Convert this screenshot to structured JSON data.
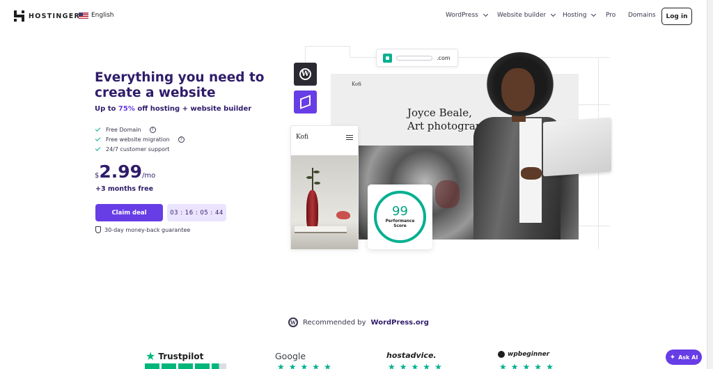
{
  "header": {
    "logo_text": "HOSTINGER",
    "language": "English",
    "nav": [
      {
        "label": "WordPress",
        "has_dropdown": true
      },
      {
        "label": "Website builder",
        "has_dropdown": true
      },
      {
        "label": "Hosting",
        "has_dropdown": true
      },
      {
        "label": "Pro",
        "has_dropdown": false
      },
      {
        "label": "Domains",
        "has_dropdown": false
      }
    ],
    "login_label": "Log in"
  },
  "hero": {
    "title": "Everything you need to create a website",
    "subtitle_prefix": "Up to ",
    "subtitle_highlight": "75%",
    "subtitle_suffix": " off hosting + website builder",
    "features": [
      {
        "label": "Free Domain",
        "has_help": true
      },
      {
        "label": "Free website migration",
        "has_help": true
      },
      {
        "label": "24/7 customer support",
        "has_help": false
      }
    ],
    "price": {
      "currency": "$",
      "amount": "2.99",
      "period": "/mo"
    },
    "bonus": "+3 months free",
    "cta_label": "Claim deal",
    "countdown": "03 : 16 : 05 : 44",
    "guarantee": "30-day money-back guarantee"
  },
  "illustration": {
    "domain_suffix": ".com",
    "site_brand": "Kofi",
    "site_headline": "Joyce Beale,\nArt photograph",
    "mobile_brand": "Kofi",
    "performance_score": "99",
    "performance_label": "Performance\nScore"
  },
  "recommended": {
    "prefix": "Recommended by",
    "brand": "WordPress.org"
  },
  "reviews": [
    {
      "name": "Trustpilot"
    },
    {
      "name": "Google"
    },
    {
      "name": "hostadvice."
    },
    {
      "name": "wpbeginner"
    }
  ],
  "ask_ai_label": "Ask AI",
  "colors": {
    "brand_purple": "#673de6",
    "heading": "#2f1c6a",
    "accent_green": "#00b090"
  }
}
